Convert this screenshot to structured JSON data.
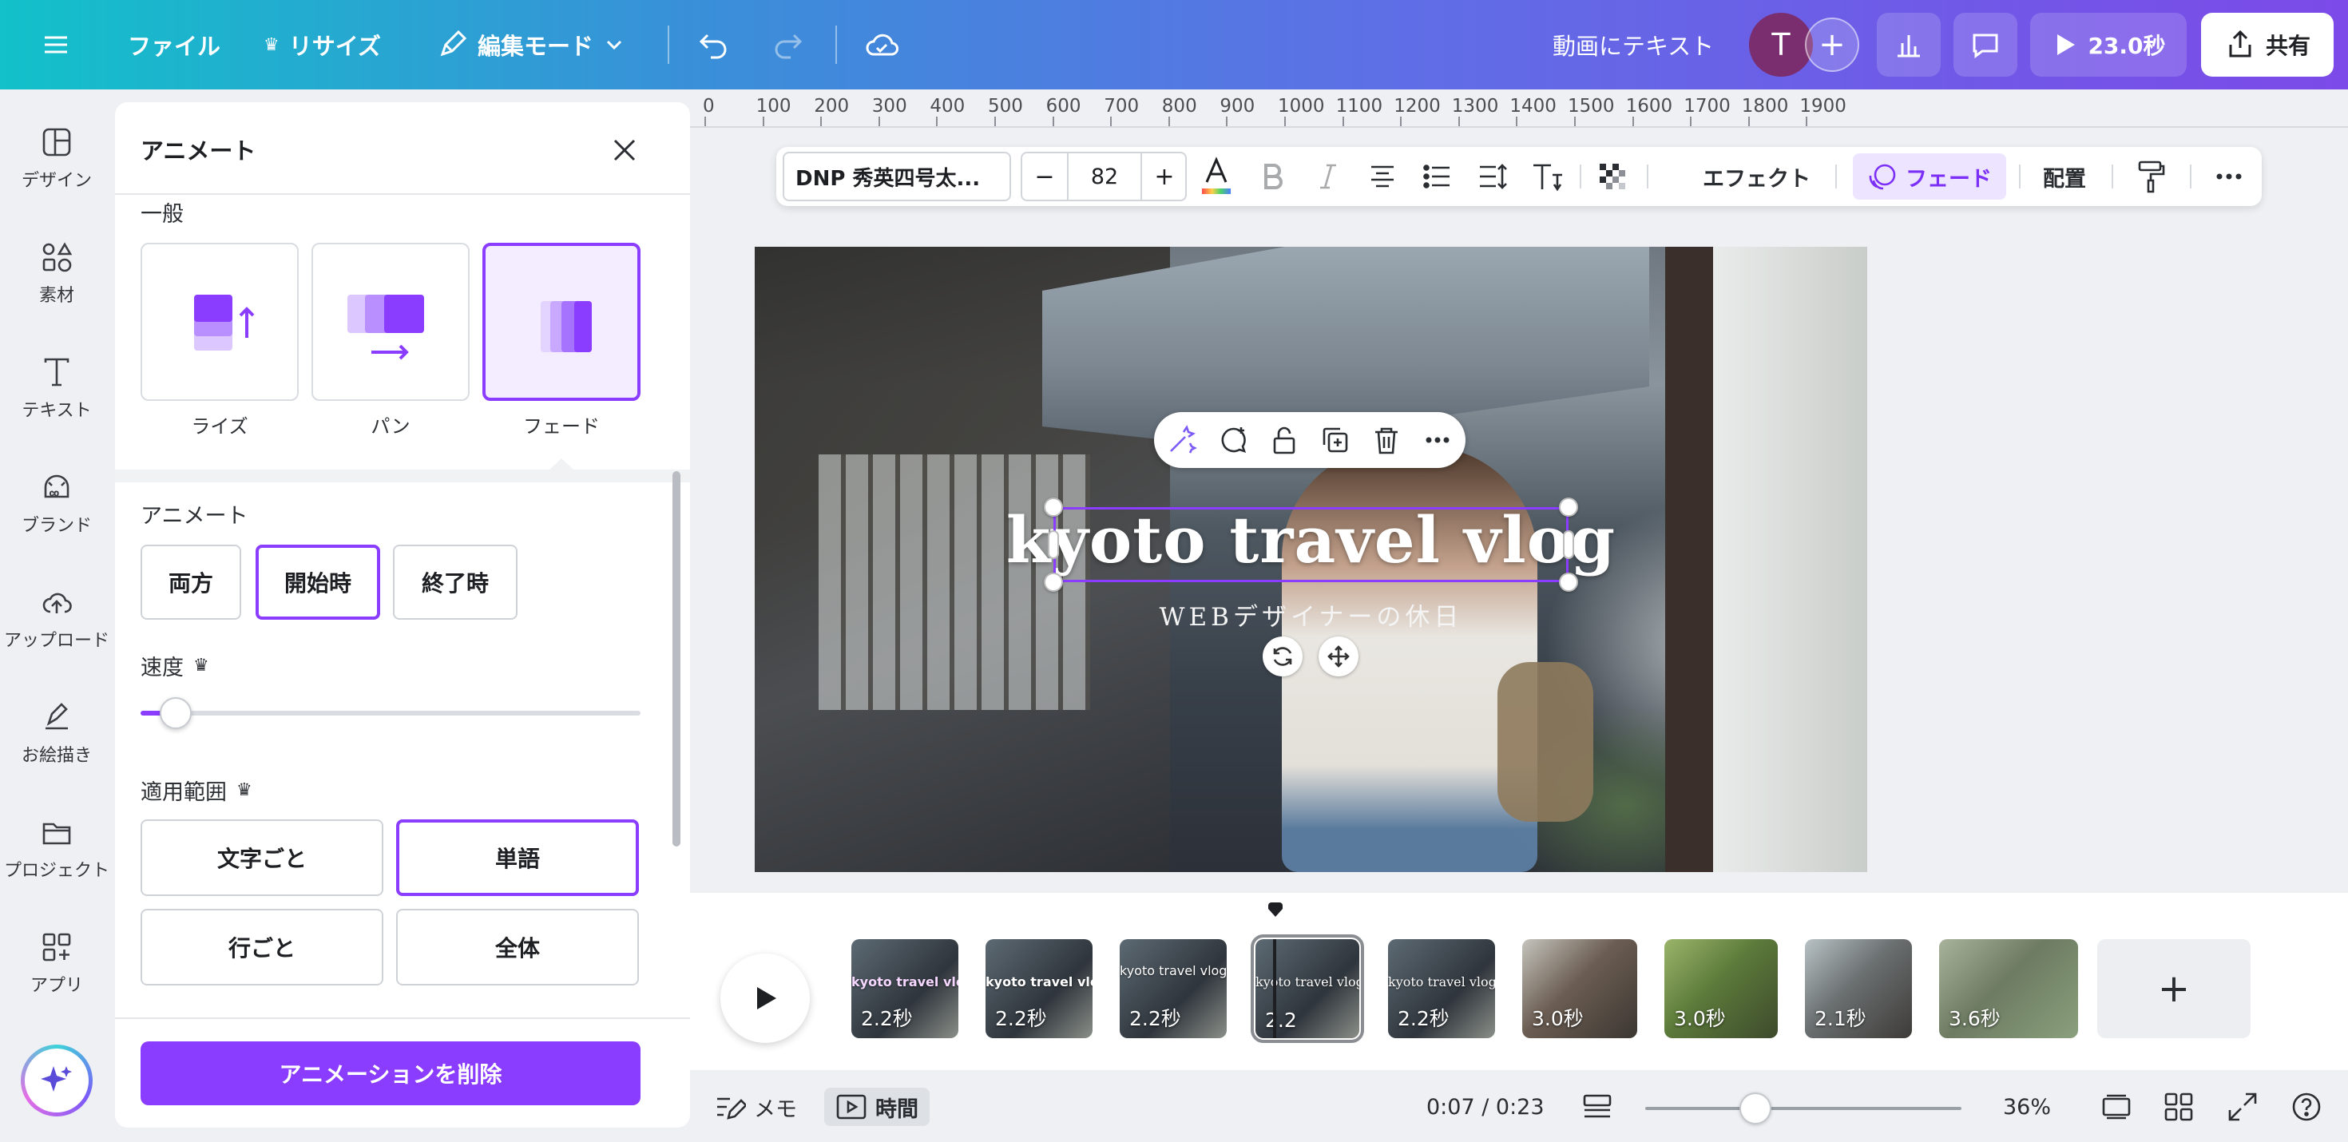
{
  "topbar": {
    "file": "ファイル",
    "resize": "リサイズ",
    "mode": "編集モード",
    "design_title": "動画にテキスト",
    "avatar_letter": "T",
    "duration": "23.0秒",
    "share": "共有"
  },
  "rail": {
    "items": [
      {
        "label": "デザイン",
        "icon": "design-icon"
      },
      {
        "label": "素材",
        "icon": "elements-icon"
      },
      {
        "label": "テキスト",
        "icon": "text-icon"
      },
      {
        "label": "ブランド",
        "icon": "brand-icon"
      },
      {
        "label": "アップロード",
        "icon": "upload-icon"
      },
      {
        "label": "お絵描き",
        "icon": "draw-icon"
      },
      {
        "label": "プロジェクト",
        "icon": "folder-icon"
      },
      {
        "label": "アプリ",
        "icon": "apps-icon"
      }
    ]
  },
  "panel": {
    "title": "アニメート",
    "general_label": "一般",
    "effects": [
      {
        "label": "ライズ",
        "selected": false
      },
      {
        "label": "パン",
        "selected": false
      },
      {
        "label": "フェード",
        "selected": true
      }
    ],
    "animate_label": "アニメート",
    "animate_options": [
      {
        "label": "両方",
        "selected": false
      },
      {
        "label": "開始時",
        "selected": true
      },
      {
        "label": "終了時",
        "selected": false
      }
    ],
    "speed_label": "速度",
    "speed_value": 0.07,
    "scope_label": "適用範囲",
    "scope_options": [
      {
        "label": "文字ごと",
        "selected": false
      },
      {
        "label": "単語",
        "selected": true
      },
      {
        "label": "行ごと",
        "selected": false
      },
      {
        "label": "全体",
        "selected": false
      }
    ],
    "delete_button": "アニメーションを削除"
  },
  "ruler": {
    "labels": [
      "0",
      "100",
      "200",
      "300",
      "400",
      "500",
      "600",
      "700",
      "800",
      "900",
      "1000",
      "1100",
      "1200",
      "1300",
      "1400",
      "1500",
      "1600",
      "1700",
      "1800",
      "1900"
    ]
  },
  "text_toolbar": {
    "font": "DNP 秀英四号太...",
    "size_minus": "−",
    "size": "82",
    "size_plus": "+",
    "effects": "エフェクト",
    "fade": "フェード",
    "position": "配置"
  },
  "canvas": {
    "title": "kyoto travel vlog",
    "subtitle": "WEBデザイナーの休日"
  },
  "timeline": {
    "clips": [
      {
        "duration": "2.2秒",
        "title": "kyoto travel vlog"
      },
      {
        "duration": "2.2秒",
        "title": "kyoto travel vlog"
      },
      {
        "duration": "2.2秒",
        "title": "kyoto  travel  vlog"
      },
      {
        "duration": "2.2",
        "title": "kyoto travel vlog"
      },
      {
        "duration": "2.2秒",
        "title": "kyoto travel vlog"
      },
      {
        "duration": "3.0秒",
        "title": ""
      },
      {
        "duration": "3.0秒",
        "title": ""
      },
      {
        "duration": "2.1秒",
        "title": ""
      },
      {
        "duration": "3.6秒",
        "title": ""
      }
    ],
    "add": "+"
  },
  "footer": {
    "notes": "メモ",
    "timer": "時間",
    "time": "0:07 / 0:23",
    "zoom_level": 0.36,
    "zoom": "36%"
  },
  "colors": {
    "accent": "#8b3dff",
    "accent_light": "#f3edff"
  }
}
